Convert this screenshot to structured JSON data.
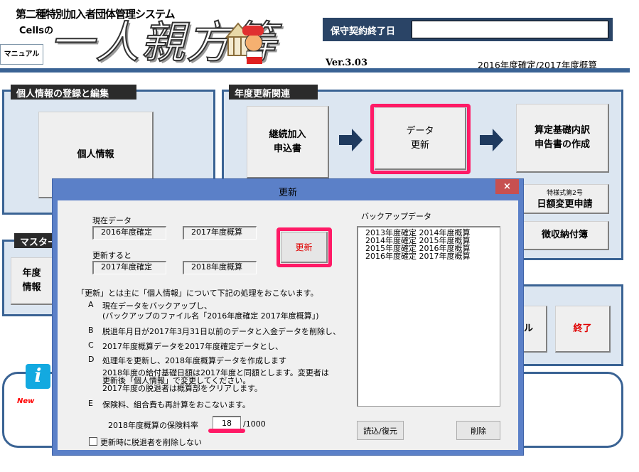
{
  "header": {
    "system_title": "第二種特別加入者団体管理システム",
    "cells_label": "Cellsの",
    "logo_text": "一人親方等",
    "manual_button": "マニュアル",
    "maintenance_label": "保守契約終了日",
    "maintenance_value": "",
    "version": "Ver.3.03",
    "fiscal_status": "2016年度確定/2017年度概算"
  },
  "panels": {
    "personal": {
      "title": "個人情報の登録と編集",
      "button": "個人情報"
    },
    "renewal": {
      "title": "年度更新関連",
      "buttons": {
        "continue_line1": "継続加入",
        "continue_line2": "申込書",
        "data_line1": "データ",
        "data_line2": "更新",
        "calc_line1": "算定基礎内訳",
        "calc_line2": "申告書の作成",
        "daily_small": "特様式第2号",
        "daily_main": "日額変更申請",
        "collection": "徴収納付簿"
      }
    },
    "master": {
      "title": "マスター",
      "button_line1": "年度",
      "button_line2": "情報"
    },
    "misc": {
      "partial_button": "ル",
      "exit_button": "終了"
    },
    "info": {
      "new_label": "New",
      "icon": "info-icon"
    }
  },
  "dialog": {
    "title": "更新",
    "close": "×",
    "current_label": "現在データ",
    "current": [
      "2016年度確定",
      "2017年度概算"
    ],
    "after_label": "更新すると",
    "after": [
      "2017年度確定",
      "2018年度概算"
    ],
    "update_button": "更新",
    "description": "「更新」とは主に「個人情報」について下記の処理をおこないます。",
    "items": [
      {
        "key": "A",
        "lines": [
          "現在データをバックアップし、",
          "(バックアップのファイル名「2016年度確定 2017年度概算」)"
        ]
      },
      {
        "key": "B",
        "lines": [
          "脱退年月日が2017年3月31日以前のデータと入金データを削除し、"
        ]
      },
      {
        "key": "C",
        "lines": [
          "2017年度概算データを2017年度確定データとし、"
        ]
      },
      {
        "key": "D",
        "lines": [
          "処理年を更新し、2018年度概算データを作成します"
        ]
      },
      {
        "key": "",
        "lines": [
          "2018年度の給付基礎日額は2017年度と同額とします。変更者は",
          "更新後「個人情報」で変更してください。",
          "2017年度の脱退者は概算部をクリアします。"
        ]
      },
      {
        "key": "E",
        "lines": [
          "保険料、組合費も再計算をおこないます。"
        ]
      }
    ],
    "rate_label": "2018年度概算の保険料率",
    "rate_value": "18",
    "rate_unit": "/1000",
    "checkbox_label": "更新時に脱退者を削除しない",
    "checkbox_checked": false,
    "backup_label": "バックアップデータ",
    "backup_list": [
      "2013年度確定 2014年度概算",
      "2014年度確定 2015年度概算",
      "2015年度確定 2016年度概算",
      "2016年度確定 2017年度概算"
    ],
    "restore_button": "読込/復元",
    "delete_button": "削除"
  },
  "colors": {
    "navy": "#2a4466",
    "bar": "#3a6394",
    "panel_bg": "#dce6f1",
    "highlight": "#ff1a66",
    "dialog_frame": "#5b80c8",
    "close": "#c75050",
    "red_text": "#e00000"
  }
}
